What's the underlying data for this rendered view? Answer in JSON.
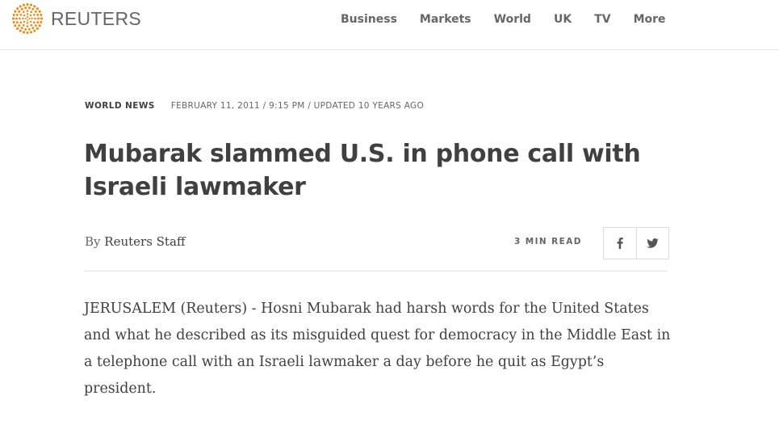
{
  "header": {
    "brand": "REUTERS",
    "brand_color": "#ff8000",
    "logo_icon": "reuters-dot-logo",
    "nav": [
      "Business",
      "Markets",
      "World",
      "UK",
      "TV",
      "More"
    ]
  },
  "article": {
    "section": "WORLD NEWS",
    "dateline": "FEBRUARY 11, 2011 / 9:15 PM / UPDATED 10 YEARS AGO",
    "headline": "Mubarak slammed U.S. in phone call with Israeli lawmaker",
    "byline_prefix": "By",
    "author": "Reuters Staff",
    "read_time": "3 MIN READ",
    "share": [
      {
        "network": "facebook",
        "icon": "facebook-icon"
      },
      {
        "network": "twitter",
        "icon": "twitter-icon"
      }
    ],
    "lead": "JERUSALEM (Reuters) - Hosni Mubarak had harsh words for the United States and what he described as its misguided quest for democracy in the Middle East in a telephone call with an Israeli lawmaker a day before he quit as Egypt’s president."
  }
}
